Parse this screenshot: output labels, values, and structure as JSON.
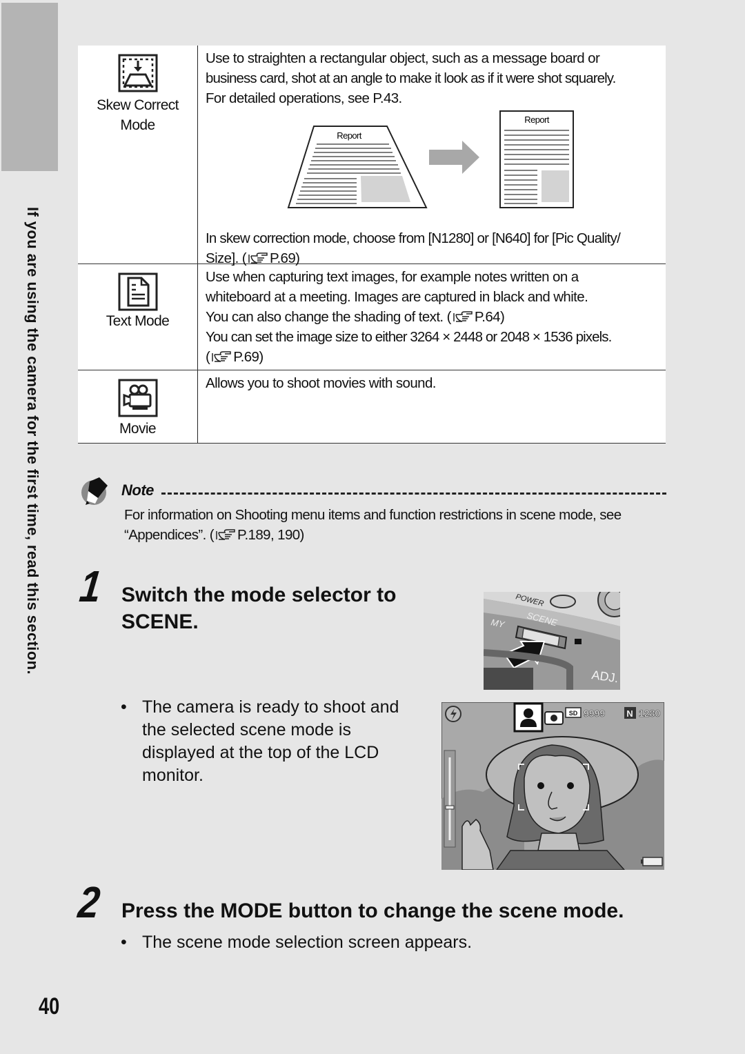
{
  "side_tab": {
    "text": "If you are using the camera for the first time, read this section."
  },
  "modes_table": {
    "rows": [
      {
        "icon": "skew-correct-icon",
        "label_lines": [
          "Skew Correct",
          "Mode"
        ],
        "description_lines": [
          "Use to straighten a rectangular object, such as a message board or",
          "business card, shot at an angle to make it look as if it were shot squarely.",
          "For detailed operations, see P.43."
        ],
        "figure": {
          "before_label": "Report",
          "after_label": "Report"
        },
        "extra_lines": [
          "In skew correction mode, choose from [N1280] or [N640] for [Pic Quality/",
          "Size]. ",
          "P.69)"
        ]
      },
      {
        "icon": "text-mode-icon",
        "label_lines": [
          "Text Mode"
        ],
        "description_lines": [
          "Use when capturing text images, for example notes written on a",
          "whiteboard at a meeting. Images are captured in black and white.",
          "You can also change the shading of text. (",
          "P.64)",
          "You can set the image size to either 3264 × 2448 or 2048 × 1536 pixels.",
          "(",
          "P.69)"
        ]
      },
      {
        "icon": "movie-icon",
        "label_lines": [
          "Movie"
        ],
        "description_lines": [
          "Allows you to shoot movies with sound."
        ]
      }
    ]
  },
  "note": {
    "title": "Note",
    "line1": "For information on Shooting menu items and function restrictions in scene mode, see",
    "line2_prefix": "“Appendices”. (",
    "line2_ref": "P.189, 190)"
  },
  "steps": [
    {
      "number": "1",
      "title_lines": [
        "Switch the mode selector to",
        "SCENE."
      ],
      "bullet_lines": [
        "The camera is ready to shoot and",
        "the selected scene mode is",
        "displayed at the top of the LCD",
        "monitor."
      ],
      "camera_labels": {
        "my": "MY",
        "scene": "SCENE",
        "adj": "ADJ.",
        "power": "POWER"
      },
      "lcd": {
        "card": "SD",
        "remaining": "9999",
        "quality": "N",
        "size": "1280"
      }
    },
    {
      "number": "2",
      "title": "Press the MODE button to change the scene mode.",
      "bullet": "The scene mode selection screen appears."
    }
  ],
  "page_number": "40"
}
